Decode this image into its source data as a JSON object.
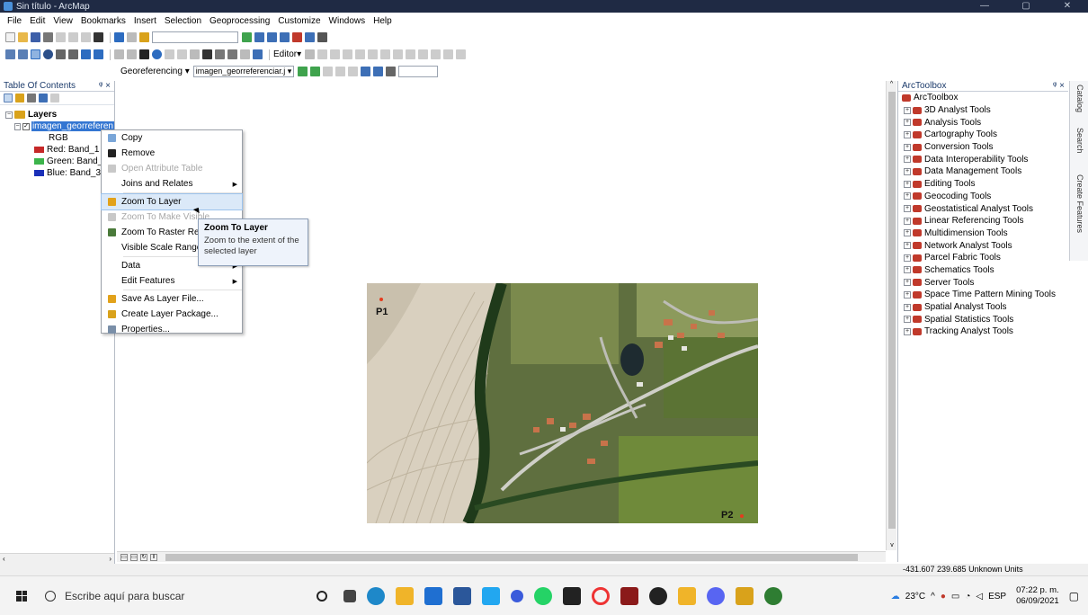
{
  "window": {
    "title": "Sin título - ArcMap",
    "controls": [
      "—",
      "▢",
      "✕"
    ]
  },
  "menu": [
    "File",
    "Edit",
    "View",
    "Bookmarks",
    "Insert",
    "Selection",
    "Geoprocessing",
    "Customize",
    "Windows",
    "Help"
  ],
  "toolbars": {
    "editor_label": "Editor▾",
    "georef_label": "Georeferencing ▾",
    "georef_layer": "imagen_georreferenciar.j ▾"
  },
  "toc": {
    "title": "Table Of Contents",
    "pin": "ᵠ ×",
    "layers_label": "Layers",
    "layer_name": "imagen_georreferen",
    "rgb_label": "RGB",
    "bands": [
      {
        "label": "Red:  Band_1",
        "color": "#c62828"
      },
      {
        "label": "Green: Band_2",
        "color": "#3cb44b"
      },
      {
        "label": "Blue:  Band_3",
        "color": "#1a2fb8"
      }
    ]
  },
  "context_menu": {
    "items": [
      {
        "label": "Copy",
        "icon": "copy-icon",
        "disabled": false,
        "submenu": false
      },
      {
        "label": "Remove",
        "icon": "remove-x-icon",
        "disabled": false,
        "submenu": false
      },
      {
        "label": "Open Attribute Table",
        "icon": "table-icon",
        "disabled": true,
        "submenu": false
      },
      {
        "label": "Joins and Relates",
        "icon": "",
        "disabled": false,
        "submenu": true
      },
      {
        "label": "Zoom To Layer",
        "icon": "zoom-to-layer-icon",
        "disabled": false,
        "submenu": false,
        "hover": true
      },
      {
        "label": "Zoom To Make Visible",
        "icon": "zoom-visible-icon",
        "disabled": true,
        "submenu": false
      },
      {
        "label": "Zoom To Raster Resolution",
        "icon": "raster-resolution-icon",
        "disabled": false,
        "submenu": false
      },
      {
        "label": "Visible Scale Range",
        "icon": "",
        "disabled": false,
        "submenu": true
      },
      {
        "label": "Data",
        "icon": "",
        "disabled": false,
        "submenu": true
      },
      {
        "label": "Edit Features",
        "icon": "",
        "disabled": false,
        "submenu": true
      },
      {
        "label": "Save As Layer File...",
        "icon": "layer-file-icon",
        "disabled": false,
        "submenu": false
      },
      {
        "label": "Create Layer Package...",
        "icon": "layer-package-icon",
        "disabled": false,
        "submenu": false
      },
      {
        "label": "Properties...",
        "icon": "properties-icon",
        "disabled": false,
        "submenu": false
      }
    ]
  },
  "tooltip": {
    "title": "Zoom To Layer",
    "body": "Zoom to the extent of the selected layer"
  },
  "map": {
    "points": [
      {
        "label": "P1"
      },
      {
        "label": "P2"
      }
    ]
  },
  "toolbox": {
    "title": "ArcToolbox",
    "pin": "ᵠ ×",
    "root": "ArcToolbox",
    "tools": [
      "3D Analyst Tools",
      "Analysis Tools",
      "Cartography Tools",
      "Conversion Tools",
      "Data Interoperability Tools",
      "Data Management Tools",
      "Editing Tools",
      "Geocoding Tools",
      "Geostatistical Analyst Tools",
      "Linear Referencing Tools",
      "Multidimension Tools",
      "Network Analyst Tools",
      "Parcel Fabric Tools",
      "Schematics Tools",
      "Server Tools",
      "Space Time Pattern Mining Tools",
      "Spatial Analyst Tools",
      "Spatial Statistics Tools",
      "Tracking Analyst Tools"
    ]
  },
  "sidetabs": [
    "Catalog",
    "Search",
    "Create Features"
  ],
  "status": {
    "coordinates": "-431.607  239.685 Unknown Units"
  },
  "taskbar": {
    "search_placeholder": "Escribe aquí para buscar",
    "weather": "23°C",
    "lang": "ESP",
    "time": "07:22 p. m.",
    "date": "06/09/2021"
  }
}
